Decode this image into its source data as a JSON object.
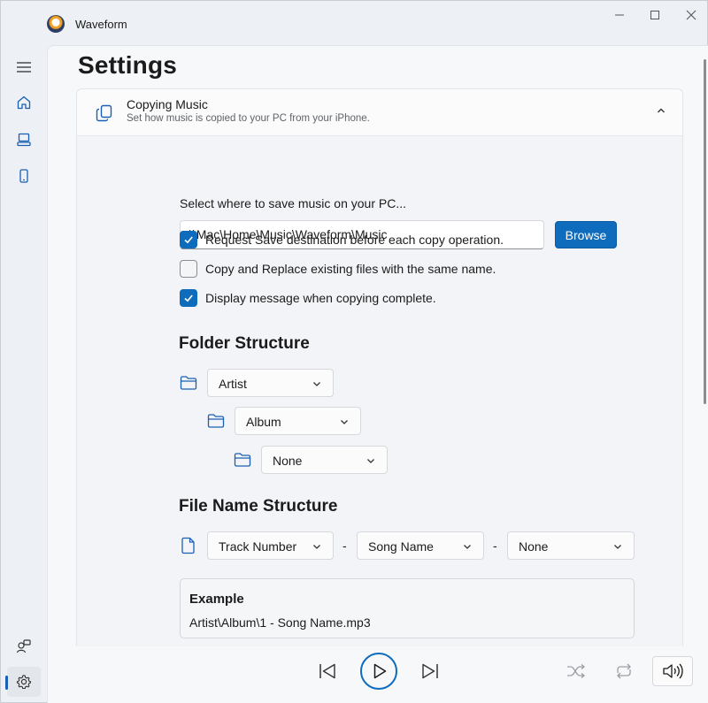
{
  "app": {
    "title": "Waveform"
  },
  "window_controls": {
    "minimize": "—",
    "maximize": "☐",
    "close": "✕"
  },
  "sidebar": {
    "items": [
      {
        "icon": "hamburger-icon"
      },
      {
        "icon": "home-icon"
      },
      {
        "icon": "computer-icon"
      },
      {
        "icon": "phone-icon"
      }
    ],
    "bottom": [
      {
        "icon": "accounts-icon"
      },
      {
        "icon": "gear-icon",
        "active": true
      }
    ]
  },
  "page": {
    "title": "Settings"
  },
  "copying_card": {
    "title": "Copying Music",
    "subtitle": "Set how music is copied to your PC from your iPhone.",
    "select_label": "Select where to save music on your PC...",
    "path_value": "\\\\Mac\\Home\\Music\\Waveform\\Music",
    "browse_label": "Browse",
    "options": [
      {
        "label": "Request Save destination before each copy operation.",
        "checked": true
      },
      {
        "label": "Copy and Replace existing files with the same name.",
        "checked": false
      },
      {
        "label": "Display message when copying complete.",
        "checked": true
      }
    ]
  },
  "folder_structure": {
    "title": "Folder Structure",
    "levels": [
      "Artist",
      "Album",
      "None"
    ]
  },
  "file_name_structure": {
    "title": "File Name Structure",
    "parts": [
      "Track Number",
      "Song Name",
      "None"
    ],
    "separators": [
      "-",
      "-"
    ]
  },
  "example": {
    "title": "Example",
    "value": "Artist\\Album\\1 - Song Name.mp3"
  },
  "colors": {
    "accent": "#0f6cbd"
  }
}
